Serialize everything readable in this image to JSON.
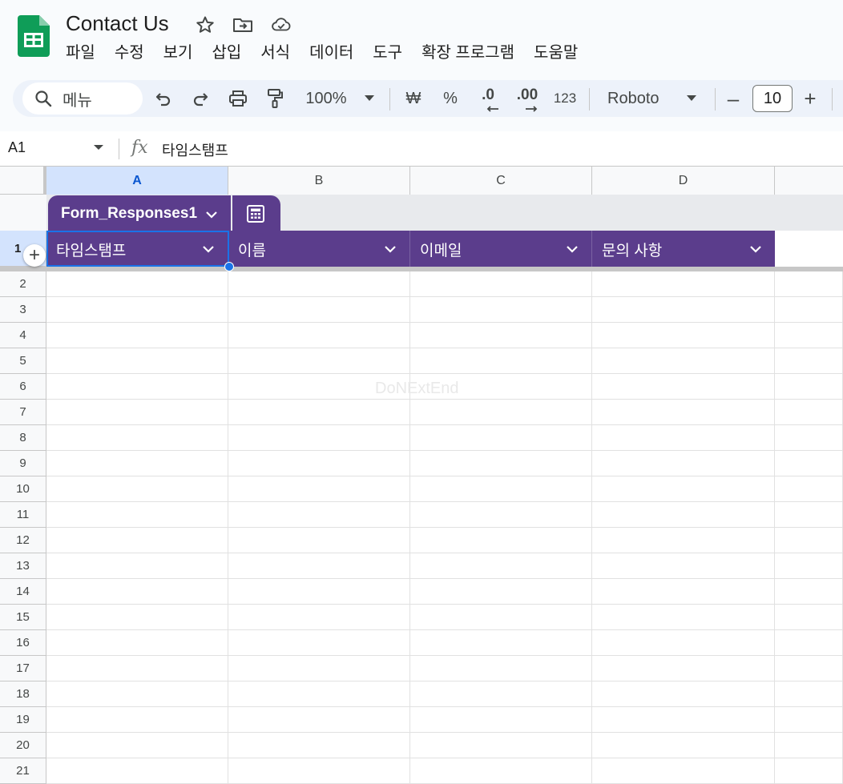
{
  "app": {
    "doc_title": "Contact Us",
    "logo_icon": "google-sheets-logo",
    "title_icons": [
      "star-icon",
      "move-to-folder-icon",
      "cloud-saved-icon"
    ]
  },
  "menubar": [
    "파일",
    "수정",
    "보기",
    "삽입",
    "서식",
    "데이터",
    "도구",
    "확장 프로그램",
    "도움말"
  ],
  "toolbar": {
    "search_label": "메뉴",
    "zoom": "100%",
    "currency": "₩",
    "percent": "%",
    "decrease_decimal": ".0",
    "increase_decimal": ".00",
    "number_format": "123",
    "font": "Roboto",
    "font_size": "10",
    "minus": "–",
    "plus": "+"
  },
  "formula_bar": {
    "name_box": "A1",
    "fx": "fx",
    "content": "타임스탬프"
  },
  "grid": {
    "columns": [
      "A",
      "B",
      "C",
      "D"
    ],
    "selected_column": "A",
    "rows": [
      "1",
      "2",
      "3",
      "4",
      "5",
      "6",
      "7",
      "8",
      "9",
      "10",
      "11",
      "12",
      "13",
      "14",
      "15",
      "16",
      "17",
      "18",
      "19",
      "20",
      "21"
    ],
    "table": {
      "name": "Form_Responses1",
      "accent": "#5b3d8c",
      "headers": [
        "타임스탬프",
        "이름",
        "이메일",
        "문의 사항"
      ]
    },
    "add_row_label": "+",
    "watermark": "DoNExtEnd"
  },
  "colors": {
    "selection": "#1a73e8",
    "header_bg": "#f8f9fa",
    "toolbar_bg": "#edf2fa",
    "sheets_green": "#0f9d58"
  }
}
